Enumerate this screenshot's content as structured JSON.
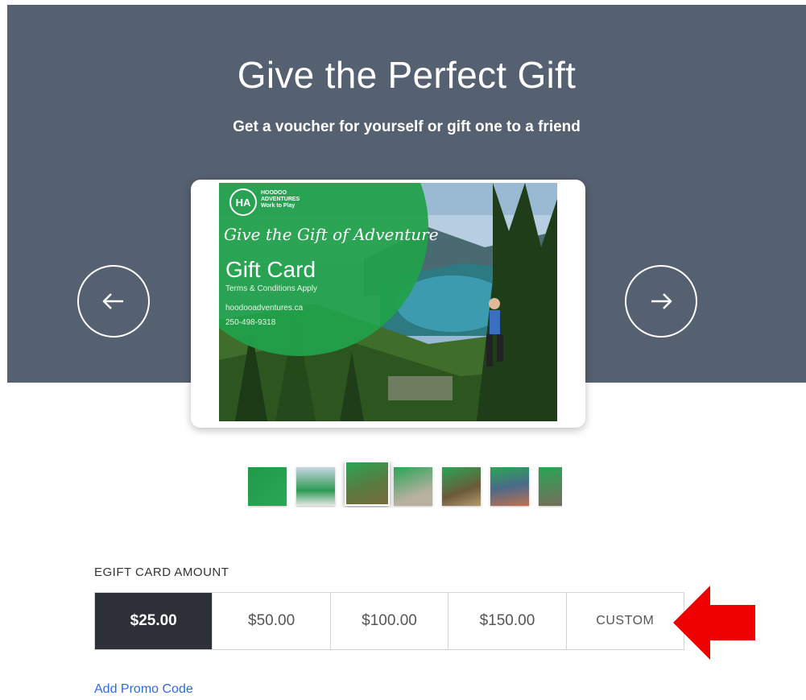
{
  "hero": {
    "title": "Give the Perfect Gift",
    "subtitle": "Get a voucher for yourself or gift one to a friend",
    "background": "#556070"
  },
  "carousel": {
    "prev_icon": "arrow-left-icon",
    "next_icon": "arrow-right-icon",
    "card": {
      "logo_mark": "HA",
      "logo_name": "HOODOO ADVENTURES",
      "logo_tagline": "Work to Play",
      "script_title": "Give the Gift of Adventure",
      "title": "Gift Card",
      "terms": "Terms & Conditions Apply",
      "website": "hoodooadventures.ca",
      "phone": "250-498-9318"
    },
    "thumbnail_count": 7,
    "active_thumbnail": 3
  },
  "amount_section": {
    "label": "EGIFT CARD AMOUNT",
    "options": [
      "$25.00",
      "$50.00",
      "$100.00",
      "$150.00",
      "CUSTOM"
    ],
    "selected": "$25.00",
    "selected_color": "#2e3038"
  },
  "promo_link": "Add Promo Code",
  "annotation": {
    "icon": "red-arrow-left-icon",
    "color": "#ee0000"
  }
}
